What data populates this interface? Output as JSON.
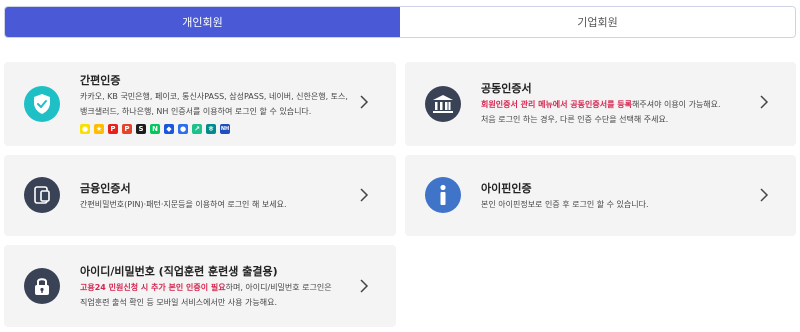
{
  "tabs": {
    "personal": "개인회원",
    "business": "기업회원"
  },
  "simple_auth": {
    "title": "간편인증",
    "desc_line1": "카카오, KB 국민은행, 페이코, 통신사PASS, 삼성PASS, 네이버, 신한은행, 토스,",
    "desc_line2": "뱅크샐러드, 하나은행, NH 인증서를 이용하여 로그인 할 수 있습니다.",
    "providers": [
      {
        "name": "kakao",
        "color": "#f9e000",
        "glyph": "●"
      },
      {
        "name": "kb",
        "color": "#ffbc00",
        "glyph": "★"
      },
      {
        "name": "payco",
        "color": "#e8221b",
        "glyph": "P"
      },
      {
        "name": "pass-telecom",
        "color": "#e6442a",
        "glyph": "P"
      },
      {
        "name": "samsung-pass",
        "color": "#1d1d1d",
        "glyph": "S"
      },
      {
        "name": "naver",
        "color": "#03c75a",
        "glyph": "N"
      },
      {
        "name": "shinhan",
        "color": "#1a56db",
        "glyph": "◆"
      },
      {
        "name": "toss",
        "color": "#2f6fed",
        "glyph": "●"
      },
      {
        "name": "banksalad",
        "color": "#1ec08b",
        "glyph": "↗"
      },
      {
        "name": "hana",
        "color": "#008c8c",
        "glyph": "ㅎ"
      },
      {
        "name": "nh",
        "color": "#1f4fbf",
        "glyph": "NH"
      }
    ]
  },
  "joint_cert": {
    "title": "공동인증서",
    "desc_line1_highlight": "회원인증서 관리 메뉴에서 공동인증서를 등록",
    "desc_line1_rest": "해주셔야 이용이 가능해요.",
    "desc_line2": "처음 로그인 하는 경우, 다른 인증 수단을 선택해 주세요."
  },
  "financial_cert": {
    "title": "금융인증서",
    "desc": "간편비밀번호(PIN)·패턴·지문등을 이용하여 로그인 해 보세요."
  },
  "ipin": {
    "title": "아이핀인증",
    "desc": "본인 아이핀정보로 인증 후 로그인 할 수 있습니다."
  },
  "id_password": {
    "title": "아이디/비밀번호 (직업훈련 훈련생 출결용)",
    "desc_line1_highlight": "고용24 민원신청 시 추가 본인 인증이 필요",
    "desc_line1_rest": "하며, 아이디/비밀번호 로그인은",
    "desc_line2": "직업훈련 출석 확인 등 모바일 서비스에서만 사용 가능해요."
  },
  "colors": {
    "accent": "#4a5ad6",
    "highlight": "#d6264f",
    "simple_auth_icon": "#1fbfc6",
    "dark_icon": "#3a4356",
    "ipin_icon": "#3f74c9"
  }
}
